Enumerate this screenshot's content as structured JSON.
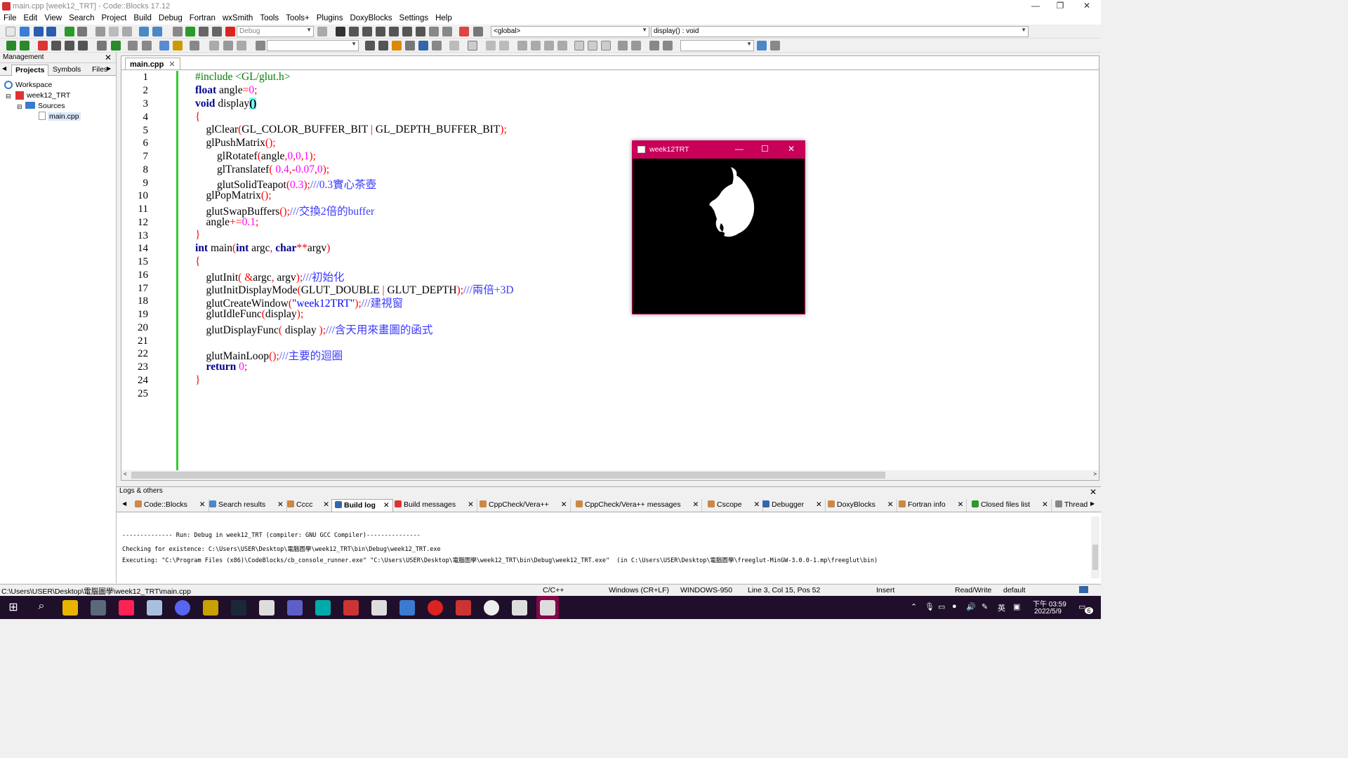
{
  "window": {
    "title": "main.cpp [week12_TRT] - Code::Blocks 17.12"
  },
  "menu": [
    "File",
    "Edit",
    "View",
    "Search",
    "Project",
    "Build",
    "Debug",
    "Fortran",
    "wxSmith",
    "Tools",
    "Tools+",
    "Plugins",
    "DoxyBlocks",
    "Settings",
    "Help"
  ],
  "toolbar": {
    "build_target": "Debug",
    "scope": "<global>",
    "function": "display() : void"
  },
  "management": {
    "title": "Management",
    "tabs": [
      "Projects",
      "Symbols",
      "Files"
    ],
    "tree": {
      "workspace": "Workspace",
      "project": "week12_TRT",
      "folder": "Sources",
      "file": "main.cpp"
    }
  },
  "editor": {
    "tab": "main.cpp",
    "line_numbers": [
      "1",
      "2",
      "3",
      "4",
      "5",
      "6",
      "7",
      "8",
      "9",
      "10",
      "11",
      "12",
      "13",
      "14",
      "15",
      "16",
      "17",
      "18",
      "19",
      "20",
      "21",
      "22",
      "23",
      "24",
      "25"
    ]
  },
  "glut_window": {
    "title": "week12TRT"
  },
  "logs": {
    "title": "Logs & others",
    "tabs": [
      "Code::Blocks",
      "Search results",
      "Cccc",
      "Build log",
      "Build messages",
      "CppCheck/Vera++",
      "CppCheck/Vera++ messages",
      "Cscope",
      "Debugger",
      "DoxyBlocks",
      "Fortran info",
      "Closed files list",
      "Thread"
    ],
    "active_tab": "Build log",
    "lines": [
      "-------------- Run: Debug in week12_TRT (compiler: GNU GCC Compiler)---------------",
      "Checking for existence: C:\\Users\\USER\\Desktop\\電腦圖學\\week12_TRT\\bin\\Debug\\week12_TRT.exe",
      "Executing: \"C:\\Program Files (x86)\\CodeBlocks/cb_console_runner.exe\" \"C:\\Users\\USER\\Desktop\\電腦圖學\\week12_TRT\\bin\\Debug\\week12_TRT.exe\"  (in C:\\Users\\USER\\Desktop\\電腦圖學\\freeglut-MinGW-3.0.0-1.mp\\freeglut\\bin)"
    ]
  },
  "status": {
    "path": "C:\\Users\\USER\\Desktop\\電腦圖學\\week12_TRT\\main.cpp",
    "lang": "C/C++",
    "eol": "Windows (CR+LF)",
    "encoding": "WINDOWS-950",
    "position": "Line 3, Col 15, Pos 52",
    "mode": "Insert",
    "access": "Read/Write",
    "profile": "default"
  },
  "taskbar": {
    "time": "下午 03:59",
    "date": "2022/5/9",
    "ime": "英",
    "notifications": "6"
  },
  "colors": {
    "accent": "#c8005a",
    "taskbar": "#1f0f2a",
    "gutter_change": "#33cc33",
    "keyword": "#00008b",
    "number": "#ff00ff",
    "comment": "#3a3aff"
  }
}
